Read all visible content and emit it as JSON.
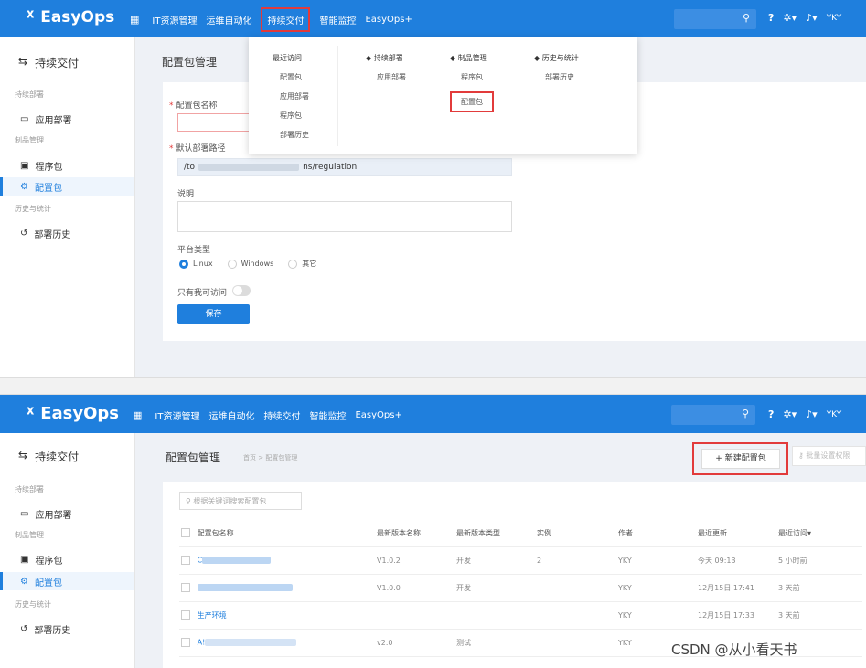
{
  "brand": {
    "logo_glyph": "ᕁ",
    "name": "EasyOps"
  },
  "nav": {
    "items": [
      "IT资源管理",
      "运维自动化",
      "持续交付",
      "智能监控",
      "EasyOps+"
    ],
    "user": "YKY"
  },
  "sidebar": {
    "title": "持续交付",
    "sections": {
      "deploy": "持续部署",
      "product": "制品管理",
      "history": "历史与统计"
    },
    "items": {
      "app_deploy": "应用部署",
      "program_pkg": "程序包",
      "config_pkg": "配置包",
      "deploy_history": "部署历史"
    }
  },
  "top_page": {
    "title": "配置包管理",
    "form": {
      "name_label": "配置包名称",
      "path_label": "默认部署路径",
      "path_prefix": "/to",
      "path_suffix": "ns/regulation",
      "desc_label": "说明",
      "platform_label": "平台类型",
      "platforms": [
        "Linux",
        "Windows",
        "其它"
      ],
      "private_label": "只有我可访问",
      "save": "保存"
    }
  },
  "dropdown": {
    "recent": {
      "title": "最近访问",
      "links": [
        "配置包",
        "应用部署",
        "程序包",
        "部署历史"
      ]
    },
    "deploy": {
      "title": "持续部署",
      "links": [
        "应用部署"
      ]
    },
    "product": {
      "title": "制品管理",
      "links": [
        "程序包",
        "配置包"
      ]
    },
    "history": {
      "title": "历史与统计",
      "links": [
        "部署历史"
      ]
    }
  },
  "bottom_page": {
    "title": "配置包管理",
    "breadcrumb": "首页 > 配置包管理",
    "new_button": "+ 新建配置包",
    "batch_button": "批量设置权限",
    "search_placeholder": "根据关键词搜索配置包",
    "table": {
      "headers": [
        "配置包名称",
        "最新版本名称",
        "最新版本类型",
        "实例",
        "作者",
        "最近更新",
        "最近访问▾"
      ],
      "rows": [
        {
          "name": "C",
          "version": "V1.0.2",
          "type": "开发",
          "instances": "2",
          "author": "YKY",
          "updated": "今天 09:13",
          "visited": "5 小时前"
        },
        {
          "name": "",
          "version": "V1.0.0",
          "type": "开发",
          "instances": "",
          "author": "YKY",
          "updated": "12月15日 17:41",
          "visited": "3 天前"
        },
        {
          "name": "生产环境",
          "version": "",
          "type": "",
          "instances": "",
          "author": "YKY",
          "updated": "12月15日 17:33",
          "visited": "3 天前"
        },
        {
          "name": "A!",
          "version": "v2.0",
          "type": "测试",
          "instances": "",
          "author": "YKY",
          "updated": "",
          "visited": ""
        }
      ]
    }
  },
  "watermark": "CSDN @从小看天书",
  "colors": {
    "primary": "#1f7fdd",
    "highlight": "#e23b3b"
  }
}
